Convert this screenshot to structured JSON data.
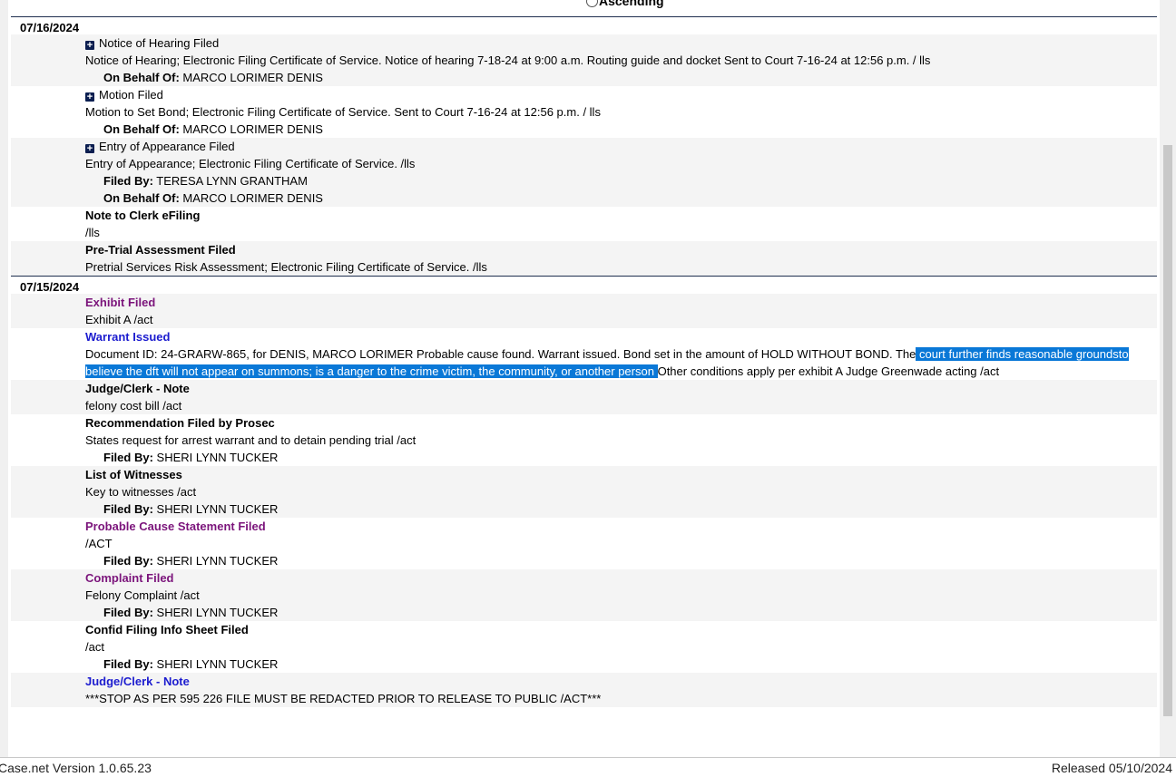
{
  "sort": {
    "option_label": "Ascending"
  },
  "groups": [
    {
      "date": "07/16/2024",
      "entries": [
        {
          "title": "Notice of Hearing Filed",
          "expandable": true,
          "style": "normal",
          "description": "Notice of Hearing; Electronic Filing Certificate of Service. Notice of hearing 7-18-24 at 9:00 a.m. Routing guide and docket Sent to Court 7-16-24 at 12:56 p.m. / lls",
          "parties": [
            {
              "label": "On Behalf Of:",
              "name": "MARCO LORIMER DENIS"
            }
          ]
        },
        {
          "title": "Motion Filed",
          "expandable": true,
          "style": "normal",
          "description": "Motion to Set Bond; Electronic Filing Certificate of Service. Sent to Court 7-16-24 at 12:56 p.m. / lls",
          "parties": [
            {
              "label": "On Behalf Of:",
              "name": "MARCO LORIMER DENIS"
            }
          ]
        },
        {
          "title": "Entry of Appearance Filed",
          "expandable": true,
          "style": "normal",
          "description": "Entry of Appearance; Electronic Filing Certificate of Service. /lls",
          "parties": [
            {
              "label": "Filed By:",
              "name": "TERESA LYNN GRANTHAM"
            },
            {
              "label": "On Behalf Of:",
              "name": "MARCO LORIMER DENIS"
            }
          ]
        },
        {
          "title": "Note to Clerk eFiling",
          "expandable": false,
          "style": "bold",
          "description": "/lls",
          "parties": []
        },
        {
          "title": "Pre-Trial Assessment Filed",
          "expandable": false,
          "style": "bold",
          "description": "Pretrial Services Risk Assessment; Electronic Filing Certificate of Service. /lls",
          "parties": []
        }
      ]
    },
    {
      "date": "07/15/2024",
      "entries": [
        {
          "title": "Exhibit Filed",
          "expandable": false,
          "style": "purple",
          "description": "Exhibit A /act",
          "parties": []
        },
        {
          "title": "Warrant Issued",
          "expandable": false,
          "style": "blue",
          "description_parts": [
            {
              "text": "Document ID: 24-GRARW-865, for DENIS, MARCO LORIMER Probable cause found. Warrant issued. Bond set in the amount of HOLD WITHOUT BOND. The",
              "highlight": false
            },
            {
              "text": " court further finds reasonable grounds",
              "highlight": true
            },
            {
              "text": "to believe the dft will not appear on summons; is a danger to the crime victim, the community, or another person ",
              "highlight": true
            },
            {
              "text": "Other conditions apply per exhibit A Judge Greenwade acting /act",
              "highlight": false
            }
          ],
          "parties": []
        },
        {
          "title": "Judge/Clerk - Note",
          "expandable": false,
          "style": "bold",
          "description": "felony cost bill /act",
          "parties": []
        },
        {
          "title": "Recommendation Filed by Prosec",
          "expandable": false,
          "style": "bold",
          "description": "States request for arrest warrant and to detain pending trial /act",
          "parties": [
            {
              "label": "Filed By:",
              "name": "SHERI LYNN TUCKER"
            }
          ]
        },
        {
          "title": "List of Witnesses",
          "expandable": false,
          "style": "bold",
          "description": "Key to witnesses /act",
          "parties": [
            {
              "label": "Filed By:",
              "name": "SHERI LYNN TUCKER"
            }
          ]
        },
        {
          "title": "Probable Cause Statement Filed",
          "expandable": false,
          "style": "purple",
          "description": "/ACT",
          "parties": [
            {
              "label": "Filed By:",
              "name": "SHERI LYNN TUCKER"
            }
          ]
        },
        {
          "title": "Complaint Filed",
          "expandable": false,
          "style": "purple",
          "description": "Felony Complaint /act",
          "parties": [
            {
              "label": "Filed By:",
              "name": "SHERI LYNN TUCKER"
            }
          ]
        },
        {
          "title": "Confid Filing Info Sheet Filed",
          "expandable": false,
          "style": "bold",
          "description": "/act",
          "parties": [
            {
              "label": "Filed By:",
              "name": "SHERI LYNN TUCKER"
            }
          ]
        },
        {
          "title": "Judge/Clerk - Note",
          "expandable": false,
          "style": "blue",
          "description": "***STOP AS PER 595 226 FILE MUST BE REDACTED PRIOR TO RELEASE TO PUBLIC /ACT***",
          "parties": []
        }
      ]
    }
  ],
  "footer": {
    "version": "Case.net Version 1.0.65.23",
    "released": "Released 05/10/2024"
  },
  "colors": {
    "purple_title": "#7b147b",
    "blue_title": "#1c1ccf",
    "highlight": "#0a78d7",
    "row_shade": "#f4f4f4"
  },
  "icons": {
    "expand": "plus-square-icon"
  }
}
